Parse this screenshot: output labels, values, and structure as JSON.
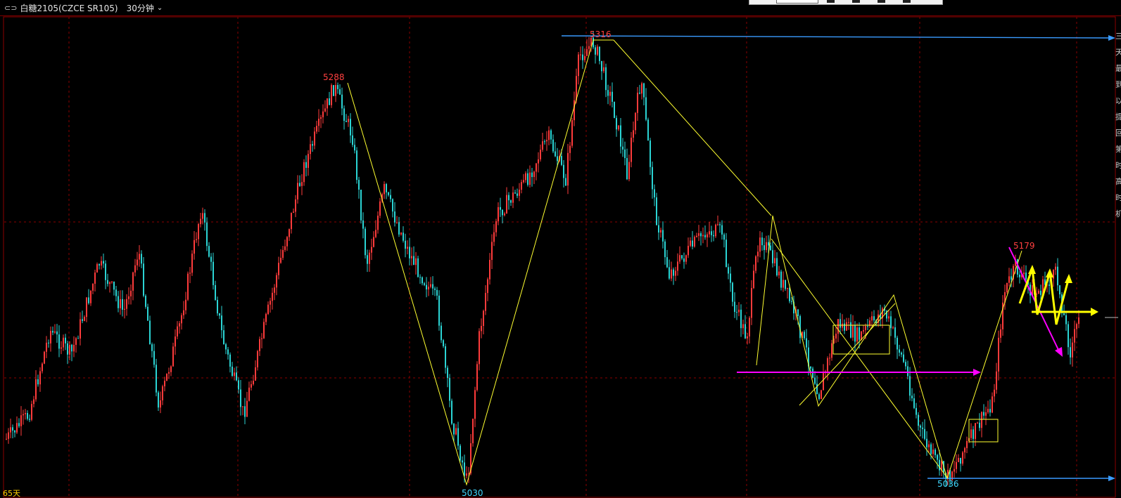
{
  "header": {
    "instrument": "白糖2105(CZCE SR105)",
    "period": "30分钟",
    "period_icon": "chevron-down-icon",
    "link_icon": "link-icon"
  },
  "toolbar_buttons": [
    "tool-1",
    "tool-2",
    "tool-3",
    "tool-4"
  ],
  "colors": {
    "up": "#ff3b3b",
    "down": "#2bd4d4",
    "trendline": "#ffff30",
    "hline": "#3a9bff",
    "magenta": "#ff00ff",
    "high_label": "#ff4040",
    "low_label": "#40d8ff",
    "grid": "#8a0000"
  },
  "price_labels": {
    "p5288": "5288",
    "p5316": "5316",
    "p5030": "5030",
    "p5036": "5036",
    "p5179": "5179"
  },
  "footer": {
    "range": "65天"
  },
  "right_strip_glyphs": [
    "三",
    "天",
    "最",
    "到",
    "以",
    "提",
    "回",
    "第",
    "时",
    "高",
    "时",
    "机"
  ]
}
